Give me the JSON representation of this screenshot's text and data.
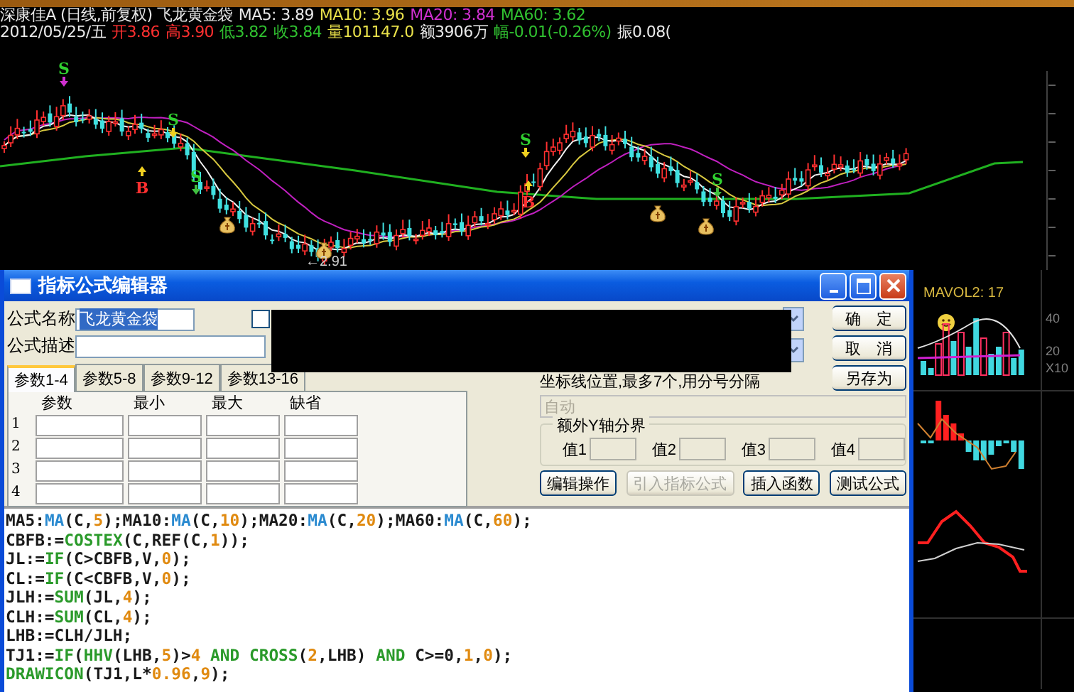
{
  "quote_header": {
    "title_items": [
      {
        "text": "深康佳A (日线,前复权) 飞龙黄金袋",
        "color": "#e8e8e8"
      },
      {
        "text": "MA5: 3.89",
        "color": "#e8e8e8"
      },
      {
        "text": "MA10: 3.96",
        "color": "#e8e04a"
      },
      {
        "text": "MA20: 3.84",
        "color": "#d030d0"
      },
      {
        "text": "MA60: 3.62",
        "color": "#30c030"
      }
    ],
    "price_items": [
      {
        "text": "2012/05/25/五",
        "color": "#e8e8e8"
      },
      {
        "text": "开3.86",
        "color": "#ff3030"
      },
      {
        "text": "高3.90",
        "color": "#ff3030"
      },
      {
        "text": "低3.82",
        "color": "#30c030"
      },
      {
        "text": "收3.84",
        "color": "#30c030"
      },
      {
        "text": "量101147.0",
        "color": "#e8e04a"
      },
      {
        "text": "额3906万",
        "color": "#e8e8e8"
      },
      {
        "text": "幅-0.01(-0.26%)",
        "color": "#30c030"
      },
      {
        "text": "振0.08(",
        "color": "#e8e8e8"
      }
    ]
  },
  "price_chart": {
    "signals": [
      {
        "label": "S",
        "kind": "sell"
      },
      {
        "label": "B",
        "kind": "buy"
      },
      {
        "label": "S",
        "kind": "sell"
      },
      {
        "label": "S",
        "kind": "sell"
      },
      {
        "label": "S",
        "kind": "sell"
      },
      {
        "label": "B",
        "kind": "buy"
      },
      {
        "label": "S",
        "kind": "sell"
      }
    ],
    "low_label": "←2.91"
  },
  "dialog": {
    "title": "指标公式编辑器",
    "name_label": "公式名称",
    "name_value": "飞龙黄金袋",
    "password_checked": false,
    "desc_label": "公式描述",
    "tabs": [
      {
        "label": "参数1-4",
        "selected": true
      },
      {
        "label": "参数5-8",
        "selected": false
      },
      {
        "label": "参数9-12",
        "selected": false
      },
      {
        "label": "参数13-16",
        "selected": false
      }
    ],
    "param_headers": [
      "参数",
      "最小",
      "最大",
      "缺省"
    ],
    "param_rows": [
      "1",
      "2",
      "3",
      "4"
    ],
    "side_buttons": [
      "确　定",
      "取　消",
      "另存为"
    ],
    "axis_hint": "坐标线位置,最多7个,用分号分隔",
    "axis_field": {
      "value": "自动",
      "disabled": true
    },
    "y_group_title": "额外Y轴分界",
    "y_values": [
      "值1",
      "值2",
      "值3",
      "值4"
    ],
    "action_buttons": [
      {
        "label": "编辑操作",
        "disabled": false
      },
      {
        "label": "引入指标公式",
        "disabled": true
      },
      {
        "label": "插入函数",
        "disabled": false
      },
      {
        "label": "测试公式",
        "disabled": false
      }
    ],
    "code_lines": [
      [
        {
          "text": "MA5:",
          "kind": "plain"
        },
        {
          "text": "MA",
          "kind": "builtin"
        },
        {
          "text": "(C,",
          "kind": "plain"
        },
        {
          "text": "5",
          "kind": "num"
        },
        {
          "text": ");MA10:",
          "kind": "plain"
        },
        {
          "text": "MA",
          "kind": "builtin"
        },
        {
          "text": "(C,",
          "kind": "plain"
        },
        {
          "text": "10",
          "kind": "num"
        },
        {
          "text": ");MA20:",
          "kind": "plain"
        },
        {
          "text": "MA",
          "kind": "builtin"
        },
        {
          "text": "(C,",
          "kind": "plain"
        },
        {
          "text": "20",
          "kind": "num"
        },
        {
          "text": ");MA60:",
          "kind": "plain"
        },
        {
          "text": "MA",
          "kind": "builtin"
        },
        {
          "text": "(C,",
          "kind": "plain"
        },
        {
          "text": "60",
          "kind": "num"
        },
        {
          "text": ");",
          "kind": "plain"
        }
      ],
      [
        {
          "text": "CBFB:=",
          "kind": "plain"
        },
        {
          "text": "COSTEX",
          "kind": "keyword"
        },
        {
          "text": "(C,REF(C,",
          "kind": "plain"
        },
        {
          "text": "1",
          "kind": "num"
        },
        {
          "text": "));",
          "kind": "plain"
        }
      ],
      [
        {
          "text": "JL:=",
          "kind": "plain"
        },
        {
          "text": "IF",
          "kind": "keyword"
        },
        {
          "text": "(C>CBFB,V,",
          "kind": "plain"
        },
        {
          "text": "0",
          "kind": "num"
        },
        {
          "text": ");",
          "kind": "plain"
        }
      ],
      [
        {
          "text": "CL:=",
          "kind": "plain"
        },
        {
          "text": "IF",
          "kind": "keyword"
        },
        {
          "text": "(C<CBFB,V,",
          "kind": "plain"
        },
        {
          "text": "0",
          "kind": "num"
        },
        {
          "text": ");",
          "kind": "plain"
        }
      ],
      [
        {
          "text": "JLH:=",
          "kind": "plain"
        },
        {
          "text": "SUM",
          "kind": "keyword"
        },
        {
          "text": "(JL,",
          "kind": "plain"
        },
        {
          "text": "4",
          "kind": "num"
        },
        {
          "text": ");",
          "kind": "plain"
        }
      ],
      [
        {
          "text": "CLH:=",
          "kind": "plain"
        },
        {
          "text": "SUM",
          "kind": "keyword"
        },
        {
          "text": "(CL,",
          "kind": "plain"
        },
        {
          "text": "4",
          "kind": "num"
        },
        {
          "text": ");",
          "kind": "plain"
        }
      ],
      [
        {
          "text": "LHB:=CLH/JLH;",
          "kind": "plain"
        }
      ],
      [
        {
          "text": "TJ1:=",
          "kind": "plain"
        },
        {
          "text": "IF",
          "kind": "keyword"
        },
        {
          "text": "(",
          "kind": "plain"
        },
        {
          "text": "HHV",
          "kind": "keyword"
        },
        {
          "text": "(LHB,",
          "kind": "plain"
        },
        {
          "text": "5",
          "kind": "num"
        },
        {
          "text": ")>",
          "kind": "plain"
        },
        {
          "text": "4",
          "kind": "num"
        },
        {
          "text": " AND CROSS",
          "kind": "keyword"
        },
        {
          "text": "(",
          "kind": "plain"
        },
        {
          "text": "2",
          "kind": "num"
        },
        {
          "text": ",LHB)",
          "kind": "plain"
        },
        {
          "text": " AND",
          "kind": "keyword"
        },
        {
          "text": " C>=0,",
          "kind": "plain"
        },
        {
          "text": "1",
          "kind": "num"
        },
        {
          "text": ",",
          "kind": "plain"
        },
        {
          "text": "0",
          "kind": "num"
        },
        {
          "text": ");",
          "kind": "plain"
        }
      ],
      [
        {
          "text": "DRAWICON",
          "kind": "keyword"
        },
        {
          "text": "(TJ1,L*",
          "kind": "plain"
        },
        {
          "text": "0.96",
          "kind": "num"
        },
        {
          "text": ",",
          "kind": "plain"
        },
        {
          "text": "9",
          "kind": "num"
        },
        {
          "text": ");",
          "kind": "plain"
        }
      ]
    ]
  },
  "side_panel": {
    "mavol_label": "MAVOL2: 17",
    "axis_labels": [
      "40",
      "20",
      "X10"
    ]
  }
}
